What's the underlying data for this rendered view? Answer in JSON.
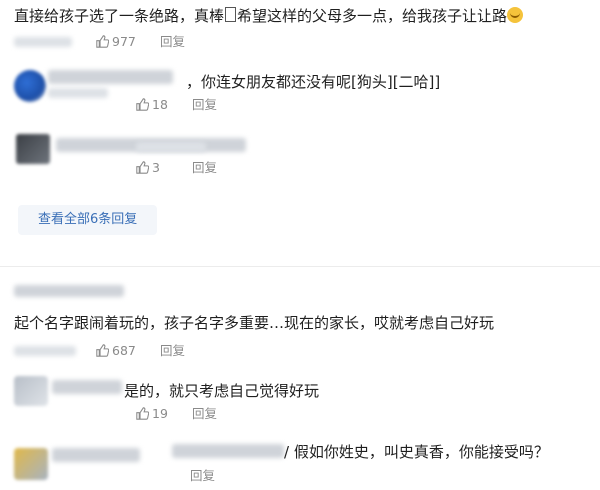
{
  "comments": [
    {
      "text_a": "直接给孩子选了一条绝路，真棒",
      "text_b": "希望这样的父母多一点，给我孩子让让路",
      "likes": "977",
      "reply_label": "回复",
      "replies": [
        {
          "text": "，你连女朋友都还没有呢[狗头][二哈]]",
          "likes": "18",
          "reply_label": "回复"
        },
        {
          "likes": "3",
          "reply_label": "回复"
        }
      ],
      "view_all_label": "查看全部6条回复"
    },
    {
      "text": "起个名字跟闹着玩的，孩子名字多重要…现在的家长，哎就考虑自己好玩",
      "likes": "687",
      "reply_label": "回复",
      "replies": [
        {
          "text": "是的，就只考虑自己觉得好玩",
          "likes": "19",
          "reply_label": "回复"
        },
        {
          "text": "假如你姓史，叫史真香，你能接受吗？",
          "reply_label": "回复"
        }
      ]
    }
  ],
  "colors": {
    "link": "#3a6fb7",
    "meta": "#8a8a8a",
    "text": "#1f1f1f"
  }
}
